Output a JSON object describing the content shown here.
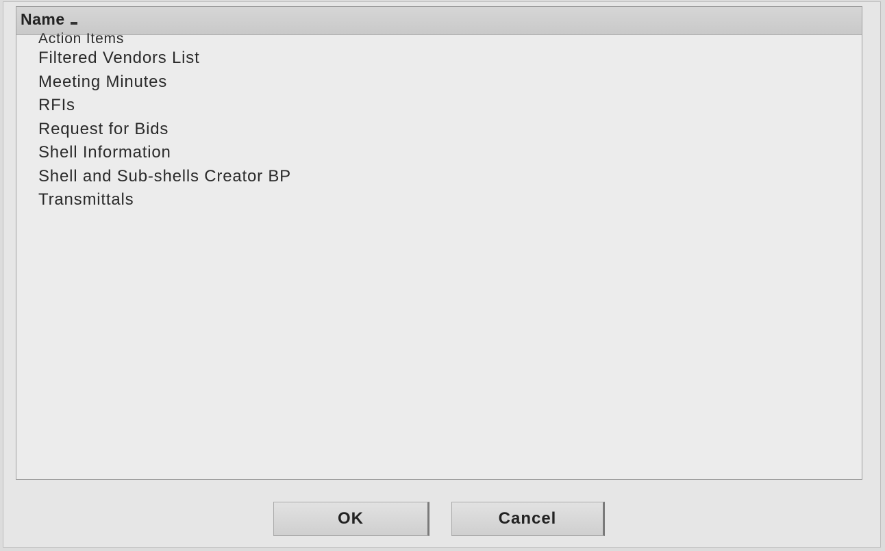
{
  "list": {
    "header": {
      "name_label": "Name",
      "sort_icon": "sort-indicator-icon"
    },
    "items": [
      {
        "label": "Action Items"
      },
      {
        "label": "Filtered Vendors List"
      },
      {
        "label": "Meeting Minutes"
      },
      {
        "label": "RFIs"
      },
      {
        "label": "Request for Bids"
      },
      {
        "label": "Shell Information"
      },
      {
        "label": "Shell and Sub-shells Creator BP"
      },
      {
        "label": "Transmittals"
      }
    ]
  },
  "buttons": {
    "ok_label": "OK",
    "cancel_label": "Cancel"
  }
}
